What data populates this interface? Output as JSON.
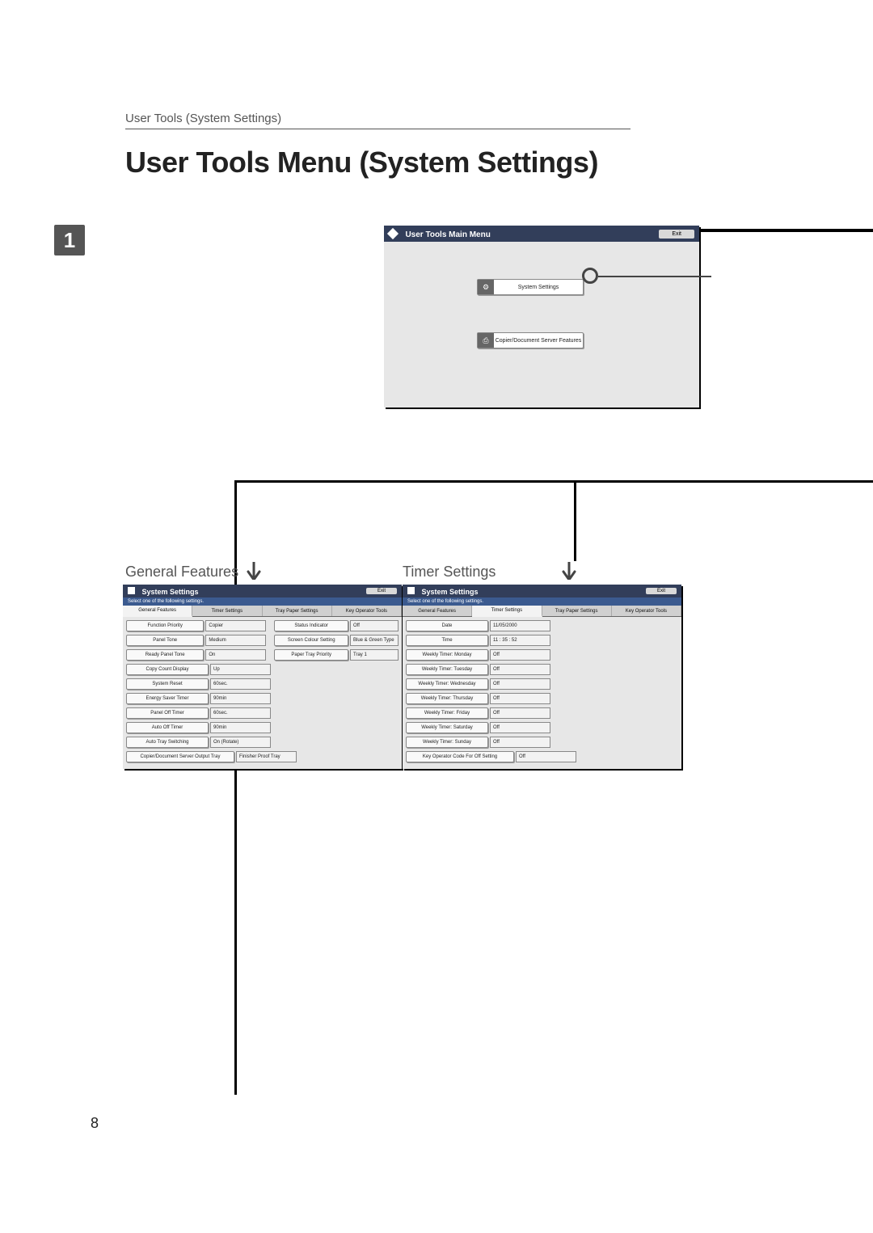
{
  "header": "User Tools (System Settings)",
  "title": "User Tools Menu (System Settings)",
  "chapter": "1",
  "page_number": "8",
  "main_menu": {
    "title": "User Tools Main Menu",
    "exit": "Exit",
    "buttons": {
      "system_settings": "System Settings",
      "copier_doc": "Copier/Document Server Features"
    }
  },
  "panel_common": {
    "title": "System Settings",
    "exit": "Exit",
    "subtitle": "Select one of the following settings.",
    "tabs": {
      "general": "General Features",
      "timer": "Timer Settings",
      "tray": "Tray Paper Settings",
      "keyop": "Key Operator Tools"
    }
  },
  "general_label": "General Features",
  "general_rows": {
    "r1a": "Function Priority",
    "v1a": "Copier",
    "r1b": "Status Indicator",
    "v1b": "Off",
    "r2a": "Panel Tone",
    "v2a": "Medium",
    "r2b": "Screen Colour Setting",
    "v2b": "Blue & Green Type",
    "r3a": "Ready Panel Tone",
    "v3a": "On",
    "r3b": "Paper Tray Priority",
    "v3b": "Tray 1",
    "r4a": "Copy Count Display",
    "v4a": "Up",
    "r5a": "System Reset",
    "v5a": "60sec.",
    "r6a": "Energy Saver Timer",
    "v6a": "90min",
    "r7a": "Panel Off Timer",
    "v7a": "60sec.",
    "r8a": "Auto Off Timer",
    "v8a": "90min",
    "r9a": "Auto Tray Switching",
    "v9a": "On (Rotate)",
    "r10a": "Copier/Document Server Output Tray",
    "v10a": "Finisher Proof Tray"
  },
  "timer_label": "Timer Settings",
  "timer_rows": {
    "r1": "Date",
    "v1": "11/05/2000",
    "r2": "Time",
    "v2": "11 : 35 : 52",
    "r3": "Weekly Timer: Monday",
    "v3": "Off",
    "r4": "Weekly Timer: Tuesday",
    "v4": "Off",
    "r5": "Weekly Timer: Wednesday",
    "v5": "Off",
    "r6": "Weekly Timer: Thursday",
    "v6": "Off",
    "r7": "Weekly Timer: Friday",
    "v7": "Off",
    "r8": "Weekly Timer: Saturday",
    "v8": "Off",
    "r9": "Weekly Timer: Sunday",
    "v9": "Off",
    "r10": "Key Operator Code For Off Setting",
    "v10": "Off"
  }
}
